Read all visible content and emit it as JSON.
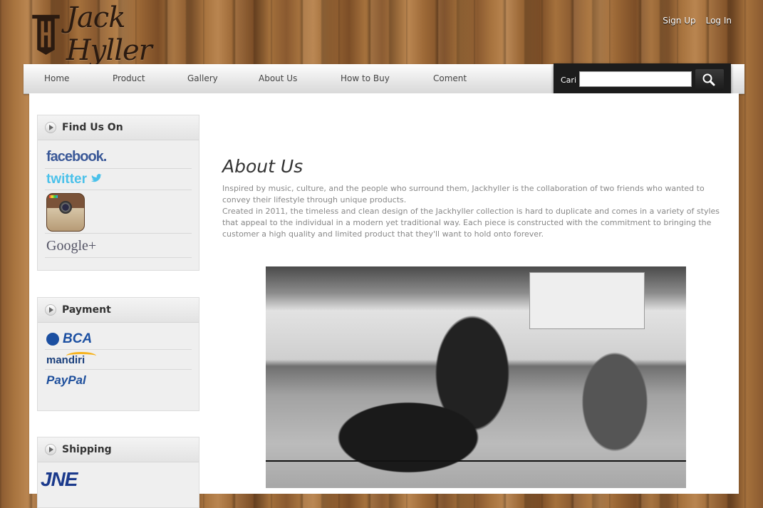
{
  "brand": {
    "logo_text": "Jack Hyller"
  },
  "auth": {
    "signup": "Sign Up",
    "login": "Log In"
  },
  "nav": [
    {
      "label": "Home"
    },
    {
      "label": "Product"
    },
    {
      "label": "Gallery"
    },
    {
      "label": "About Us"
    },
    {
      "label": "How to Buy"
    },
    {
      "label": "Coment"
    }
  ],
  "search": {
    "label": "Cari",
    "value": "",
    "icon": "search-icon"
  },
  "sidebar": {
    "find_us": {
      "title": "Find Us On",
      "items": [
        {
          "label": "facebook."
        },
        {
          "label": "twitter"
        },
        {
          "icon": "instagram-icon"
        },
        {
          "label": "Google+"
        }
      ]
    },
    "payment": {
      "title": "Payment",
      "items": [
        {
          "label": "BCA"
        },
        {
          "label": "mandiri"
        },
        {
          "label": "PayPal"
        }
      ]
    },
    "shipping": {
      "title": "Shipping",
      "items": [
        {
          "label": "JNE"
        }
      ]
    }
  },
  "main": {
    "title": "About Us",
    "paragraphs": [
      "Inspired by music, culture, and the people who surround them, Jackhyller is the collaboration of two friends who wanted to convey their lifestyle through unique products.",
      "Created in 2011, the timeless and clean design of the Jackhyller collection is hard to duplicate and comes in a variety of styles that appeal to the individual in a modern yet traditional way. Each piece is constructed with the commitment to bringing the customer a high quality and limited product that they'll want to hold onto forever."
    ]
  },
  "colors": {
    "content_bg": "#ffffff",
    "nav_bg": "#e6e6e6",
    "search_bg": "#1c1c1c",
    "text_gray": "#888888"
  }
}
